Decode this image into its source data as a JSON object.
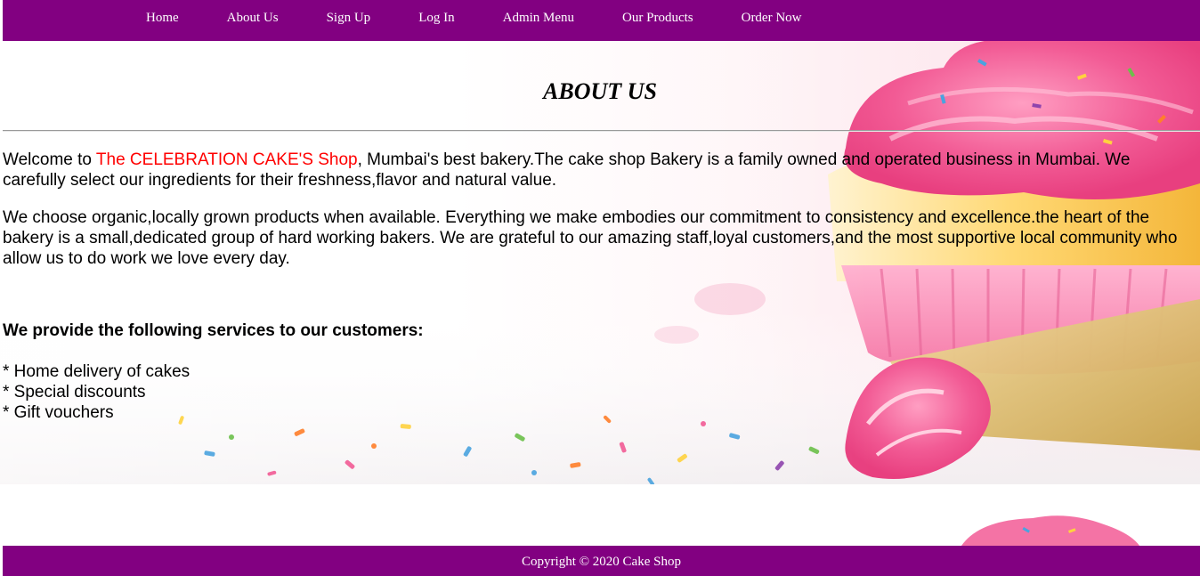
{
  "nav": {
    "items": [
      {
        "label": "Home"
      },
      {
        "label": "About Us"
      },
      {
        "label": "Sign Up"
      },
      {
        "label": "Log In"
      },
      {
        "label": "Admin Menu"
      },
      {
        "label": "Our Products"
      },
      {
        "label": "Order Now"
      }
    ]
  },
  "main": {
    "title": "ABOUT US",
    "intro": {
      "before": "Welcome to ",
      "shop_name": "The CELEBRATION CAKE'S Shop",
      "after": ", Mumbai's best bakery.The cake shop Bakery is a family owned and operated business in Mumbai. We carefully select our ingredients for their freshness,flavor and natural value."
    },
    "paragraph2": "We choose organic,locally grown products when available. Everything we make embodies our commitment to consistency and excellence.the heart of the bakery is a small,dedicated group of hard working bakers. We are grateful to our amazing staff,loyal customers,and the most supportive local community who allow us to do work we love every day.",
    "services_heading": "We provide the following services to our customers:",
    "services": [
      "* Home delivery of cakes",
      "* Special discounts",
      "* Gift vouchers"
    ]
  },
  "footer": {
    "copyright": "Copyright © 2020 Cake Shop"
  },
  "colors": {
    "nav_background": "#820081",
    "shop_name": "#ff0000",
    "text": "#000000"
  },
  "background_image": {
    "icon": "cupcake-illustration"
  }
}
